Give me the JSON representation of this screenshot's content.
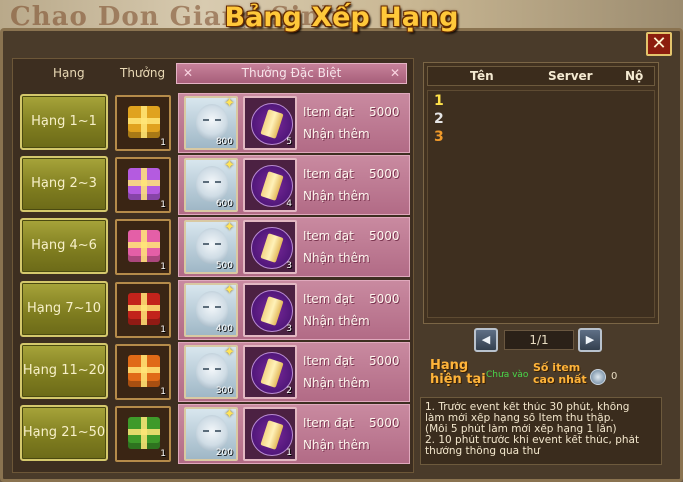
{
  "background": {
    "text": "Chao Don Giang Sinh"
  },
  "window": {
    "title": "Bảng Xếp Hạng",
    "close": "✕"
  },
  "left": {
    "headers": {
      "rank": "Hạng",
      "reward": "Thưởng",
      "special": "Thưởng Đặc Biệt"
    },
    "rows": [
      {
        "rank": "Hạng 1~1",
        "gift_color": "#e0a21e",
        "gift_qty": "1",
        "face_qty": "800",
        "scroll_qty": "5",
        "item_label": "Item đạt",
        "item_value": "5000",
        "bonus_label": "Nhận thêm"
      },
      {
        "rank": "Hạng 2~3",
        "gift_color": "#b45be0",
        "gift_qty": "1",
        "face_qty": "600",
        "scroll_qty": "4",
        "item_label": "Item đạt",
        "item_value": "5000",
        "bonus_label": "Nhận thêm"
      },
      {
        "rank": "Hạng 4~6",
        "gift_color": "#e45fa7",
        "gift_qty": "1",
        "face_qty": "500",
        "scroll_qty": "3",
        "item_label": "Item đạt",
        "item_value": "5000",
        "bonus_label": "Nhận thêm"
      },
      {
        "rank": "Hạng 7~10",
        "gift_color": "#c2231b",
        "gift_qty": "1",
        "face_qty": "400",
        "scroll_qty": "3",
        "item_label": "Item đạt",
        "item_value": "5000",
        "bonus_label": "Nhận thêm"
      },
      {
        "rank": "Hạng 11~20",
        "gift_color": "#e06a17",
        "gift_qty": "1",
        "face_qty": "300",
        "scroll_qty": "2",
        "item_label": "Item đạt",
        "item_value": "5000",
        "bonus_label": "Nhận thêm"
      },
      {
        "rank": "Hạng 21~50",
        "gift_color": "#3e9a2a",
        "gift_qty": "1",
        "face_qty": "200",
        "scroll_qty": "1",
        "item_label": "Item đạt",
        "item_value": "5000",
        "bonus_label": "Nhận thêm"
      }
    ]
  },
  "right": {
    "headers": {
      "name": "Tên",
      "server": "Server",
      "no": "Nộ"
    },
    "ranks": [
      {
        "num": "1",
        "color": "#ffe24a"
      },
      {
        "num": "2",
        "color": "#e6e6e6"
      },
      {
        "num": "3",
        "color": "#f09a2a"
      }
    ],
    "pager": {
      "prev": "◀",
      "display": "1/1",
      "next": "▶"
    },
    "current_rank": {
      "label_line1": "Hạng",
      "label_line2": "hiện tại",
      "value": "Chưa vào"
    },
    "max_item": {
      "label_line1": "Số item",
      "label_line2": "cao nhất",
      "value": "0"
    },
    "notes": [
      "1. Trước event kết thúc 30 phút, không",
      "làm mới xếp hạng số Item thu thập.",
      "(Mỗi 5 phút làm mới xếp hạng 1 lần)",
      "2. 10 phút trước khi event kết thúc, phát",
      " thưởng thông qua thư"
    ]
  }
}
